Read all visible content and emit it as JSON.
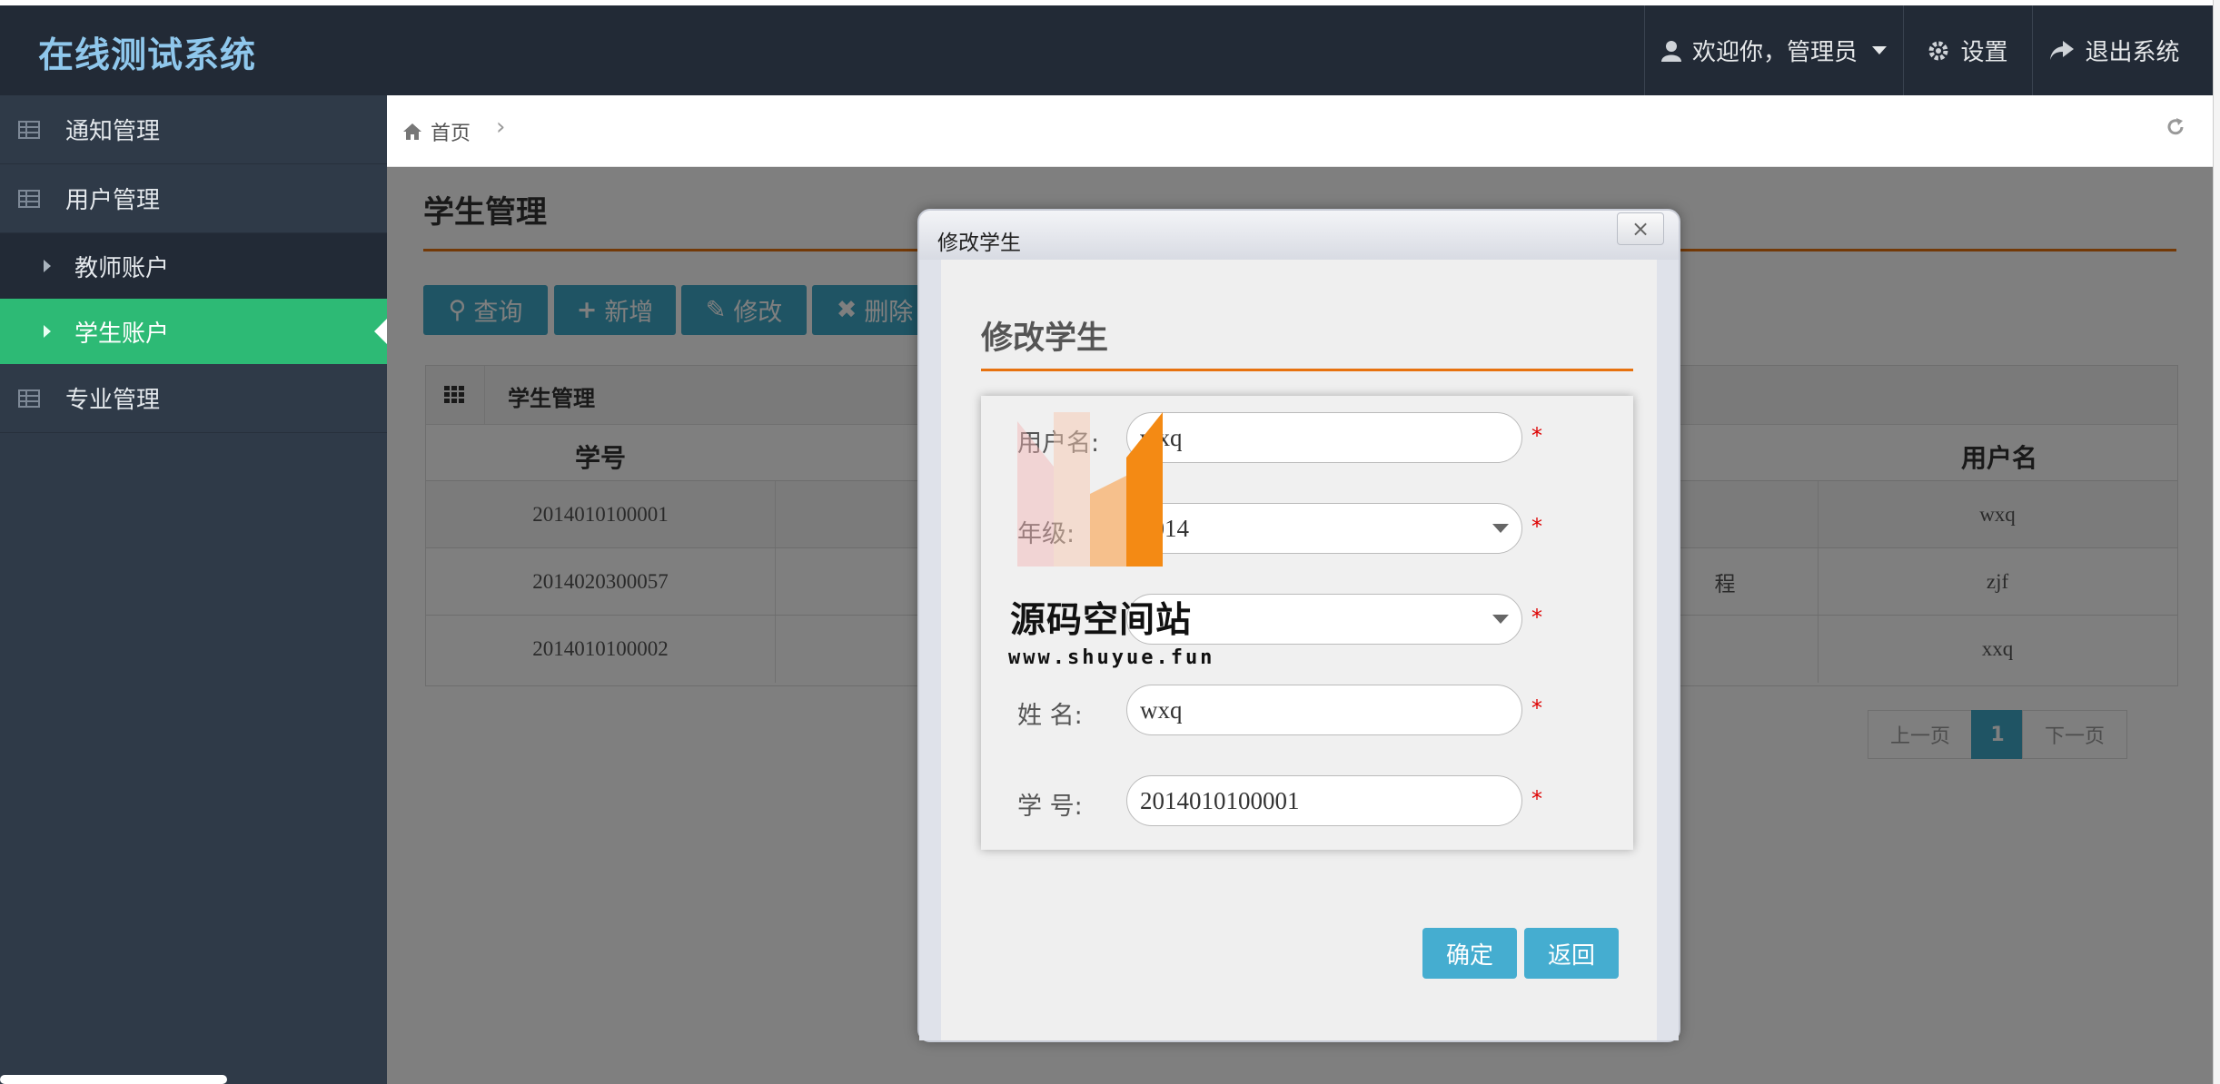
{
  "app": {
    "title": "在线测试系统"
  },
  "header": {
    "user_label": "欢迎你，管理员",
    "settings_label": "设置",
    "logout_label": "退出系统"
  },
  "sidebar": {
    "items": [
      {
        "label": "通知管理"
      },
      {
        "label": "用户管理"
      },
      {
        "label": "教师账户"
      },
      {
        "label": "学生账户"
      },
      {
        "label": "专业管理"
      }
    ],
    "active": "学生账户"
  },
  "breadcrumb": {
    "home": "首页"
  },
  "page": {
    "title": "学生管理",
    "toolbar": {
      "query": "查询",
      "add": "新增",
      "edit": "修改",
      "delete": "删除"
    },
    "panel_title": "学生管理",
    "columns": {
      "id": "学号",
      "username": "用户名"
    },
    "rows": [
      {
        "id": "2014010100001",
        "middle": "",
        "username": "wxq"
      },
      {
        "id": "2014020300057",
        "middle": "程",
        "username": "zjf"
      },
      {
        "id": "2014010100002",
        "middle": "",
        "username": "xxq"
      }
    ],
    "pager": {
      "prev": "上一页",
      "current": "1",
      "next": "下一页"
    }
  },
  "modal": {
    "window_title": "修改学生",
    "close": "×",
    "form_title": "修改学生",
    "fields": {
      "username": {
        "label": "用户名:",
        "value": "wxq"
      },
      "class": {
        "label": "年级:",
        "value": "2014"
      },
      "major": {
        "label": "",
        "value": ""
      },
      "name": {
        "label": "姓 名:",
        "value": "wxq"
      },
      "student_no": {
        "label": "学 号:",
        "value": "2014010100001"
      }
    },
    "required_mark": "*",
    "confirm": "确定",
    "back": "返回"
  },
  "watermark": {
    "text": "源码空间站",
    "url": "www.shuyue.fun"
  },
  "colors": {
    "header_bg": "#222a36",
    "sidebar_bg": "#2f3a48",
    "active_green": "#2dba75",
    "accent_blue": "#3fa9c8",
    "rule_orange": "#e7720f"
  }
}
